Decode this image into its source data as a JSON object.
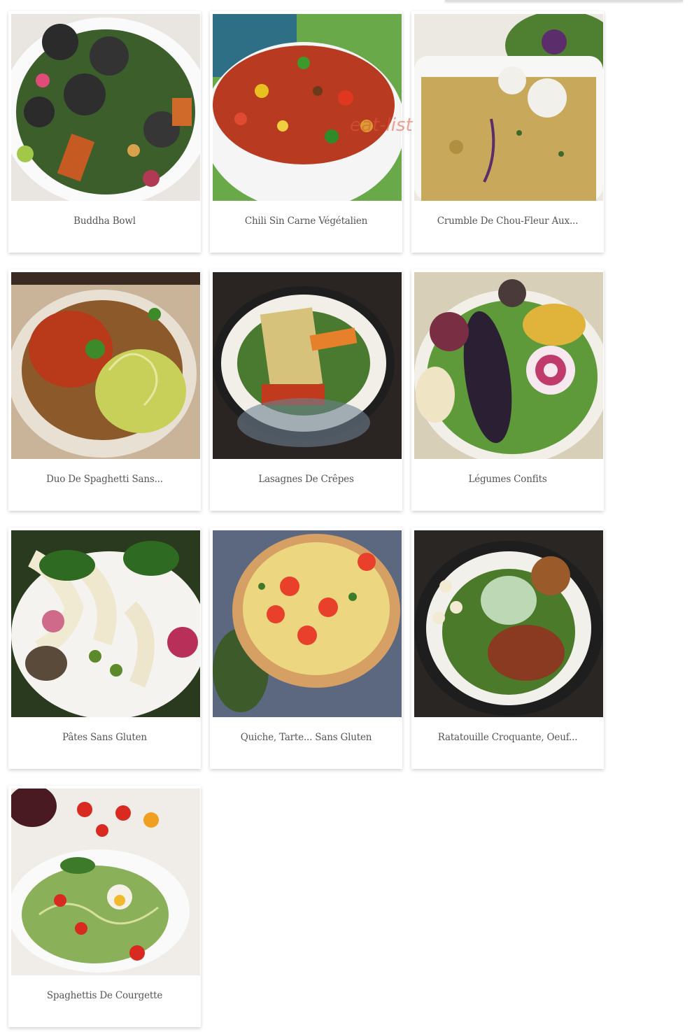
{
  "watermark": "eat-list",
  "recipes": [
    {
      "title": "Buddha Bowl",
      "image": "buddha-bowl-photo"
    },
    {
      "title": "Chili Sin Carne Végétalien",
      "image": "chili-photo"
    },
    {
      "title": "Crumble De Chou-Fleur Aux...",
      "image": "crumble-photo"
    },
    {
      "title": "Duo De Spaghetti Sans...",
      "image": "spaghetti-duo-photo"
    },
    {
      "title": "Lasagnes De Crêpes",
      "image": "lasagnes-photo"
    },
    {
      "title": "Légumes Confits",
      "image": "legumes-photo"
    },
    {
      "title": "Pâtes Sans Gluten",
      "image": "pates-photo"
    },
    {
      "title": "Quiche, Tarte... Sans Gluten",
      "image": "quiche-photo"
    },
    {
      "title": "Ratatouille Croquante, Oeuf...",
      "image": "ratatouille-photo"
    },
    {
      "title": "Spaghettis De Courgette",
      "image": "courgette-photo"
    }
  ]
}
